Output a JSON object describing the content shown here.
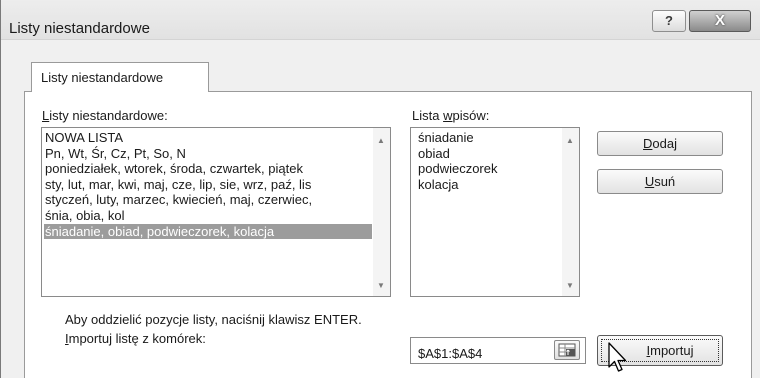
{
  "window": {
    "title": "Listy niestandardowe",
    "help_label": "?",
    "close_label": "X"
  },
  "tab": {
    "label": "Listy niestandardowe"
  },
  "custom_lists": {
    "label_first": "L",
    "label_rest": "isty niestandardowe:",
    "items": [
      "NOWA LISTA",
      "Pn, Wt, Śr, Cz, Pt, So, N",
      "poniedziałek, wtorek, środa, czwartek, piątek",
      "sty, lut, mar, kwi, maj, cze, lip, sie, wrz, paź, lis",
      "styczeń, luty, marzec, kwiecień, maj, czerwiec,",
      "śnia, obia, kol",
      "śniadanie, obiad, podwieczorek, kolacja"
    ],
    "selected_index": 6
  },
  "entries": {
    "label_pre": "Lista ",
    "label_u": "w",
    "label_post": "pisów:",
    "items": [
      "śniadanie",
      "obiad",
      "podwieczorek",
      "kolacja"
    ]
  },
  "buttons": {
    "add_u": "D",
    "add_rest": "odaj",
    "delete_u": "U",
    "delete_rest": "suń",
    "import_u": "I",
    "import_rest": "mportuj"
  },
  "hint": "Aby oddzielić pozycje listy, naciśnij klawisz ENTER.",
  "import_cells": {
    "label_u": "I",
    "label_rest": "mportuj listę z komórek:",
    "value": "$A$1:$A$4"
  }
}
